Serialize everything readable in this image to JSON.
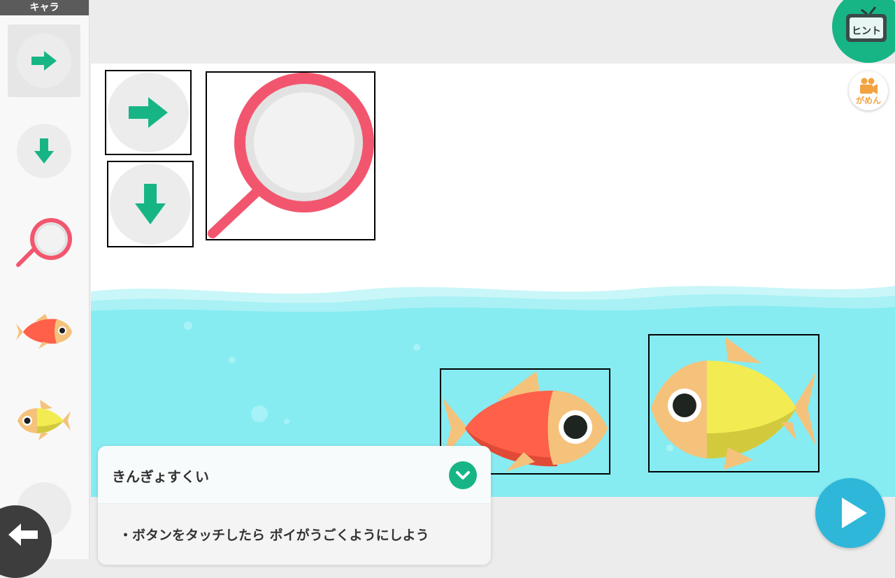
{
  "sidebar": {
    "header": "キャラ",
    "items": [
      {
        "name": "right-arrow-sprite",
        "icon": "arrow-right-icon",
        "selected": true
      },
      {
        "name": "down-arrow-sprite",
        "icon": "arrow-down-icon",
        "selected": false
      },
      {
        "name": "scoop-net-sprite",
        "icon": "magnifier-net-icon",
        "selected": false
      },
      {
        "name": "red-fish-sprite",
        "icon": "red-fish-icon",
        "selected": false
      },
      {
        "name": "yellow-fish-sprite",
        "icon": "yellow-fish-icon",
        "selected": false
      }
    ]
  },
  "hint_button": {
    "label": "ヒント"
  },
  "screen_button": {
    "label": "がめん"
  },
  "mission": {
    "title": "きんぎょすくい",
    "text": "・ボタンをタッチしたら ポイがうごくようにしよう"
  },
  "colors": {
    "accent_green": "#17b585",
    "water": "#86ecf2",
    "net_red": "#f2566e",
    "play_blue": "#2eb7d8",
    "fish_red": "#ff604a",
    "fish_yellow": "#f2ec52",
    "fish_tan": "#f5c27b"
  }
}
